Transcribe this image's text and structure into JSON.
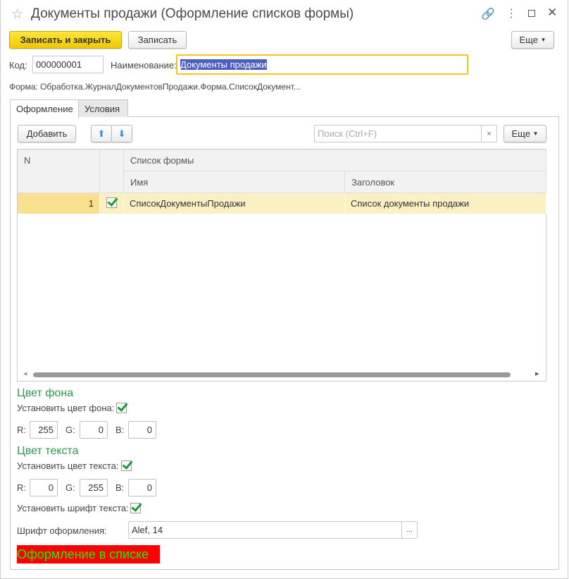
{
  "window": {
    "title": "Документы продажи (Оформление списков формы)"
  },
  "toolbar": {
    "save_close": "Записать и закрыть",
    "save": "Записать",
    "more": "Еще"
  },
  "header": {
    "code_label": "Код:",
    "code_value": "000000001",
    "name_label": "Наименование:",
    "name_value": "Документы продажи",
    "form_label": "Форма:",
    "form_value": "Обработка.ЖурналДокументовПродажи.Форма.СписокДокумент..."
  },
  "tabs": [
    {
      "label": "Оформление",
      "active": true
    },
    {
      "label": "Условия",
      "active": false
    }
  ],
  "list_toolbar": {
    "add": "Добавить",
    "search_placeholder": "Поиск (Ctrl+F)",
    "clear": "×",
    "more": "Еще"
  },
  "table": {
    "col_n": "N",
    "group_header": "Список формы",
    "col_name": "Имя",
    "col_caption": "Заголовок",
    "rows": [
      {
        "n": "1",
        "checked": true,
        "name": "СписокДокументыПродажи",
        "caption": "Список документы продажи"
      }
    ]
  },
  "background": {
    "title": "Цвет фона",
    "set_label": "Установить цвет фона:",
    "r_label": "R:",
    "g_label": "G:",
    "b_label": "B:",
    "r": "255",
    "g": "0",
    "b": "0"
  },
  "text_color": {
    "title": "Цвет текста",
    "set_label": "Установить цвет текста:",
    "r_label": "R:",
    "g_label": "G:",
    "b_label": "B:",
    "r": "0",
    "g": "255",
    "b": "0"
  },
  "font": {
    "set_label": "Установить шрифт текста:",
    "font_label": "Шрифт оформления:",
    "font_value": "Alef, 14",
    "choose": "..."
  },
  "preview": {
    "text": "Оформление в списке",
    "bg": "#ff0000",
    "fg": "#00ff00"
  }
}
